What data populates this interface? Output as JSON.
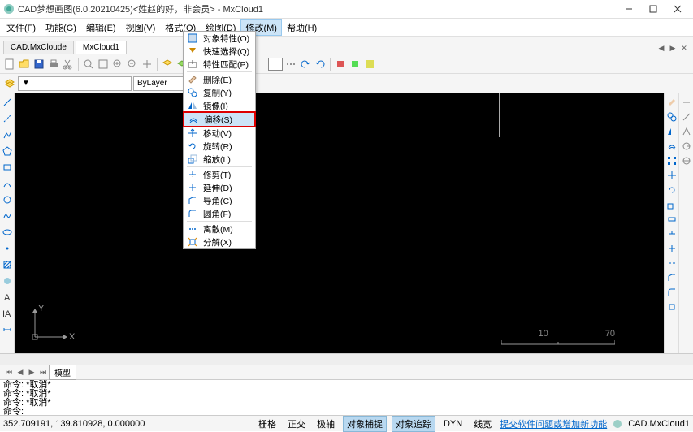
{
  "title": "CAD梦想画图(6.0.20210425)<姓赵的好，非会员> - MxCloud1",
  "menubar": [
    "文件(F)",
    "功能(G)",
    "编辑(E)",
    "视图(V)",
    "格式(O)",
    "绘图(D)",
    "修改(M)",
    "帮助(H)"
  ],
  "doc_tabs": [
    "CAD.MxCloude",
    "MxCloud1"
  ],
  "active_doc_tab": 1,
  "layer_combo": "ByLayer",
  "layer_combo2": "ByLayer",
  "dropdown": {
    "items": [
      {
        "label": "对象特性(O)"
      },
      {
        "label": "快速选择(Q)"
      },
      {
        "label": "特性匹配(P)"
      },
      {
        "sep": true
      },
      {
        "label": "删除(E)"
      },
      {
        "label": "复制(Y)"
      },
      {
        "label": "镜像(I)"
      },
      {
        "label": "偏移(S)",
        "highlighted": true,
        "boxed": true
      },
      {
        "label": "移动(V)"
      },
      {
        "label": "旋转(R)"
      },
      {
        "label": "缩放(L)"
      },
      {
        "sep": true
      },
      {
        "label": "修剪(T)"
      },
      {
        "label": "延伸(D)"
      },
      {
        "label": "导角(C)"
      },
      {
        "label": "圆角(F)"
      },
      {
        "sep": true
      },
      {
        "label": "离散(M)"
      },
      {
        "label": "分解(X)"
      }
    ]
  },
  "command_lines": [
    "命令: *取消*",
    "命令: *取消*",
    "命令: *取消*",
    "命令:"
  ],
  "model_tabs": [
    "模型"
  ],
  "coords": "352.709191,  139.810928,  0.000000",
  "status_toggles": [
    "栅格",
    "正交",
    "极轴",
    "对象捕捉",
    "对象追踪",
    "DYN",
    "线宽"
  ],
  "status_on": [
    "对象捕捉",
    "对象追踪"
  ],
  "status_link": "提交软件问题或增加新功能",
  "status_doc": "CAD.MxCloud1",
  "scale_labels": [
    "10",
    "70"
  ],
  "ucs_labels": {
    "x": "X",
    "y": "Y"
  }
}
